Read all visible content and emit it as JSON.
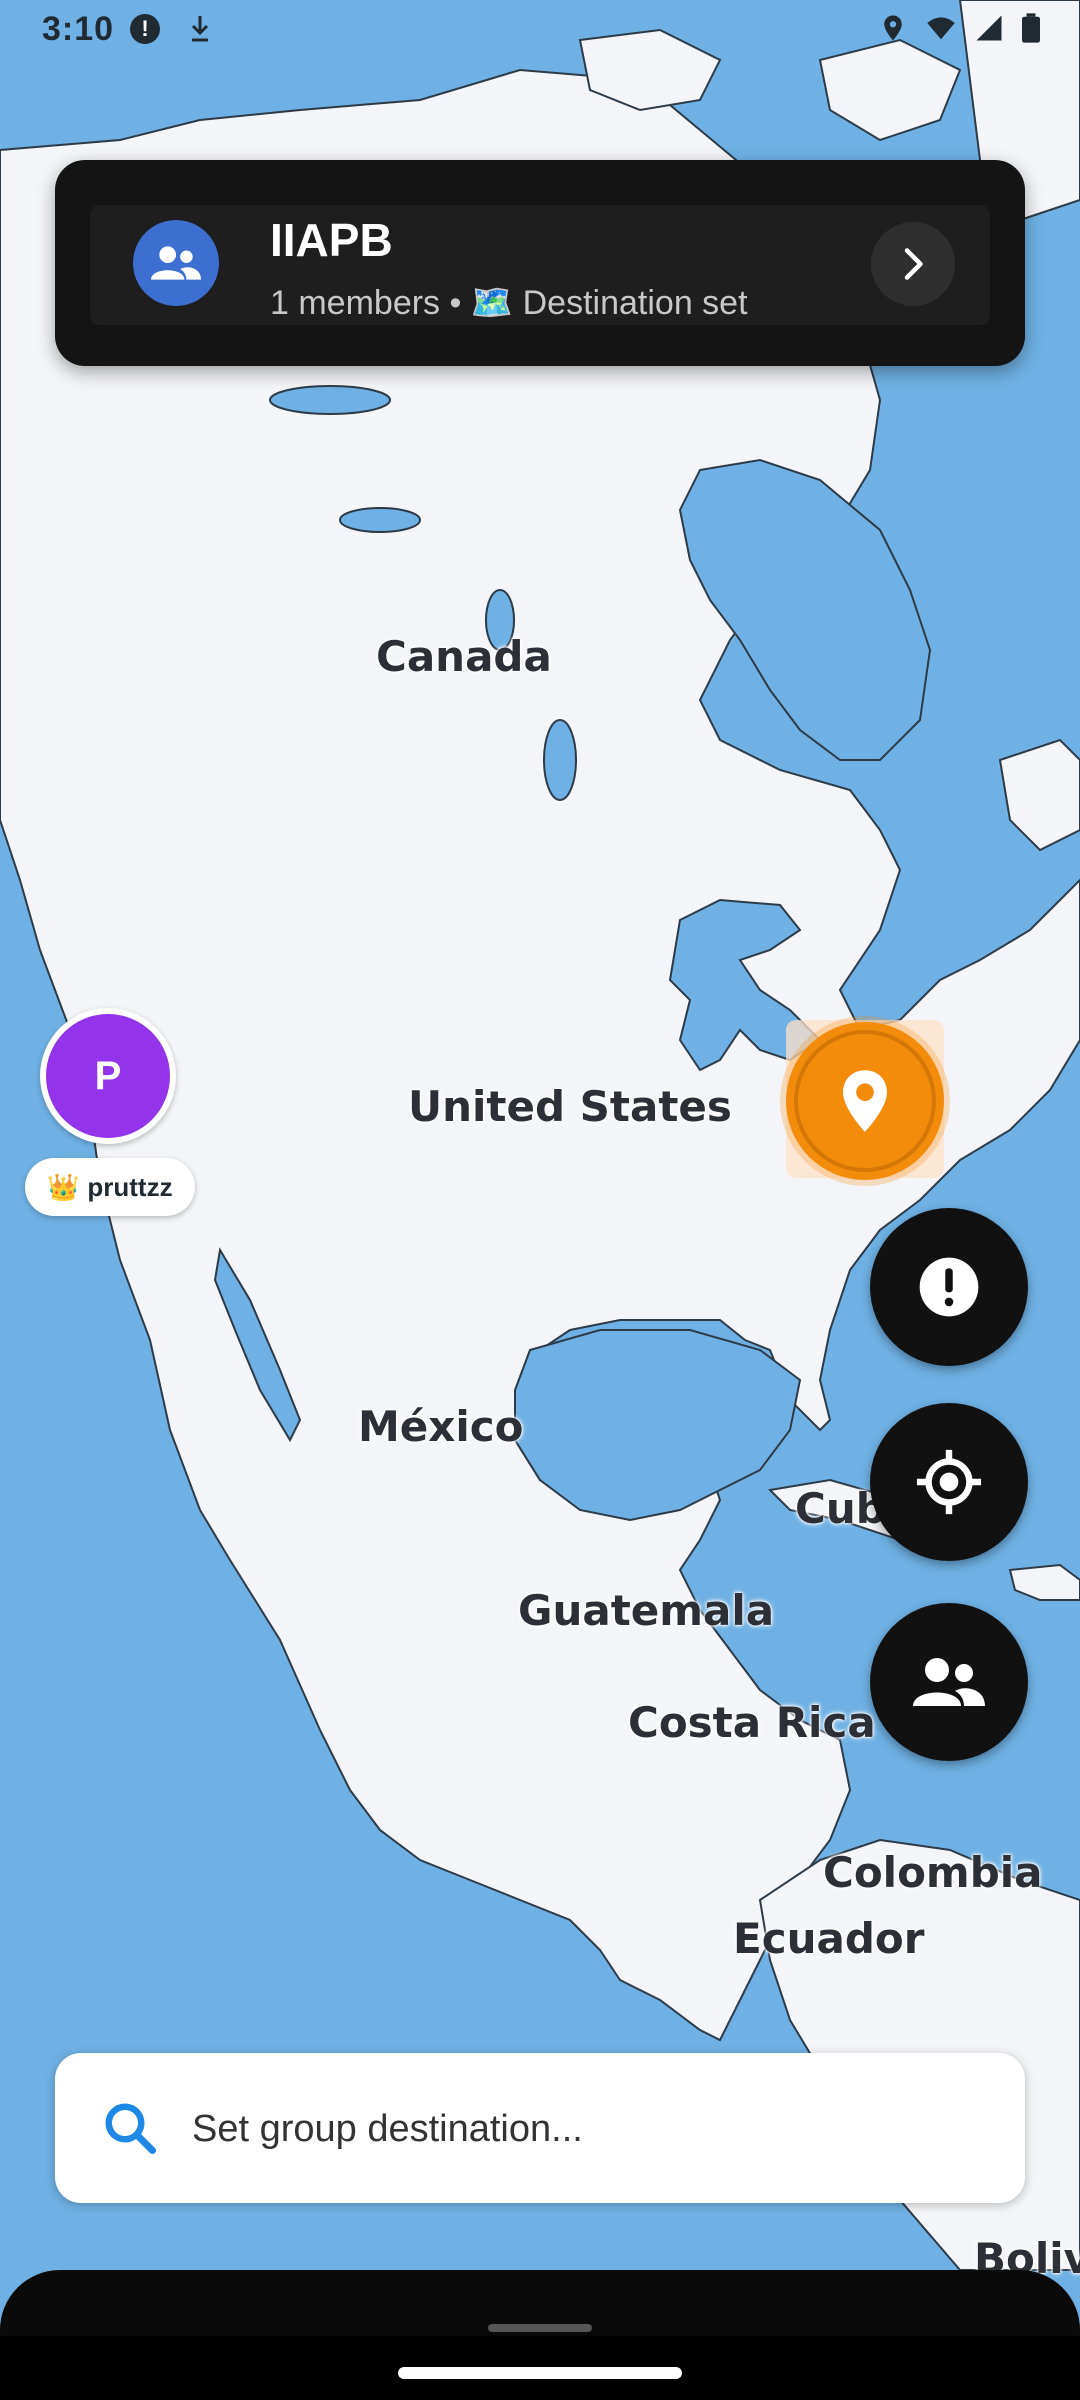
{
  "status_bar": {
    "time": "3:10",
    "alert_glyph": "!"
  },
  "map": {
    "labels": {
      "canada": "Canada",
      "united_states": "United States",
      "mexico": "México",
      "cuba": "Cuba",
      "guatemala": "Guatemala",
      "costa_rica": "Costa Rica",
      "colombia": "Colombia",
      "ecuador": "Ecuador",
      "bolivia_partial": "Boliv"
    }
  },
  "group_card": {
    "name": "IIAPB",
    "subtitle": "1 members • 🗺️ Destination set"
  },
  "member": {
    "initial": "P",
    "badge_emoji": "👑",
    "username": "pruttzz"
  },
  "fabs": {
    "alert_icon": "exclamation-icon",
    "locate_icon": "crosshair-icon",
    "group_icon": "people-icon"
  },
  "search": {
    "placeholder": "Set group destination...",
    "value": ""
  },
  "colors": {
    "water": "#6fb1e4",
    "land": "#f4f5f8",
    "avatar": "#9333ea",
    "destination": "#f28c0a",
    "group_icon_bg": "#3d6fd1",
    "accent_search": "#1e88e5"
  }
}
